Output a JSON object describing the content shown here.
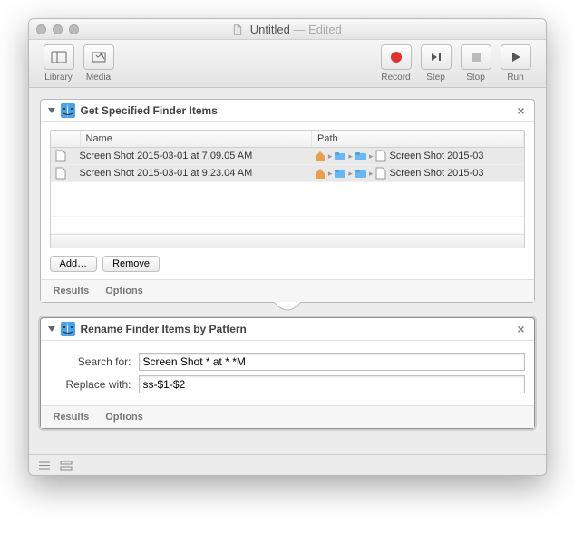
{
  "window": {
    "title": "Untitled",
    "edited_suffix": "— Edited"
  },
  "toolbar": {
    "library": "Library",
    "media": "Media",
    "record": "Record",
    "step": "Step",
    "stop": "Stop",
    "run": "Run"
  },
  "actions": {
    "get_items": {
      "title": "Get Specified Finder Items",
      "columns": {
        "name": "Name",
        "path": "Path"
      },
      "rows": [
        {
          "name": "Screen Shot 2015-03-01 at 7.09.05 AM",
          "path_tail": "Screen Shot 2015-03"
        },
        {
          "name": "Screen Shot 2015-03-01 at 9.23.04 AM",
          "path_tail": "Screen Shot 2015-03"
        }
      ],
      "buttons": {
        "add": "Add…",
        "remove": "Remove"
      }
    },
    "rename": {
      "title": "Rename Finder Items by Pattern",
      "search_label": "Search for:",
      "search_value": "Screen Shot * at * *M",
      "replace_label": "Replace with:",
      "replace_value": "ss-$1-$2"
    },
    "footer": {
      "results": "Results",
      "options": "Options"
    }
  }
}
